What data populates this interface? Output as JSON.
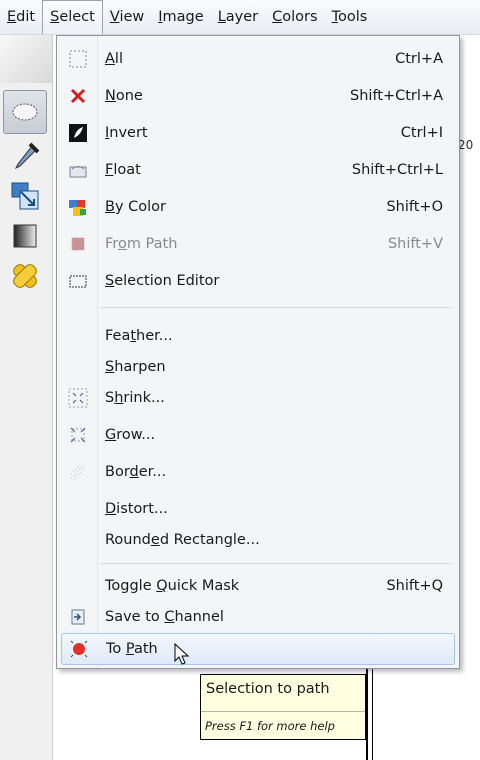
{
  "menubar": {
    "items": [
      {
        "label": "Edit",
        "mnemonic": "E"
      },
      {
        "label": "Select",
        "mnemonic": "S"
      },
      {
        "label": "View",
        "mnemonic": "V"
      },
      {
        "label": "Image",
        "mnemonic": "I"
      },
      {
        "label": "Layer",
        "mnemonic": "L"
      },
      {
        "label": "Colors",
        "mnemonic": "C"
      },
      {
        "label": "Tools",
        "mnemonic": "T"
      }
    ],
    "active": "Select"
  },
  "ruler": {
    "label": "20"
  },
  "select_menu": {
    "items": [
      {
        "label": "All",
        "underline": "A",
        "shortcut": "Ctrl+A",
        "icon": "select-all-icon"
      },
      {
        "label": "None",
        "underline": "N",
        "shortcut": "Shift+Ctrl+A",
        "icon": "select-none-icon"
      },
      {
        "label": "Invert",
        "underline": "I",
        "shortcut": "Ctrl+I",
        "icon": "invert-icon"
      },
      {
        "label": "Float",
        "underline": "F",
        "shortcut": "Shift+Ctrl+L",
        "icon": "float-icon"
      },
      {
        "label": "By Color",
        "underline": "B",
        "shortcut": "Shift+O",
        "icon": "by-color-icon"
      },
      {
        "label": "From Path",
        "underline": "o",
        "shortcut": "Shift+V",
        "icon": "from-path-icon",
        "disabled": true
      },
      {
        "label": "Selection Editor",
        "underline": "S",
        "shortcut": "",
        "icon": "selection-editor-icon"
      },
      {
        "label": "Feather...",
        "underline": "t",
        "shortcut": ""
      },
      {
        "label": "Sharpen",
        "underline": "S",
        "shortcut": ""
      },
      {
        "label": "Shrink...",
        "underline": "h",
        "shortcut": "",
        "icon": "shrink-icon"
      },
      {
        "label": "Grow...",
        "underline": "G",
        "shortcut": "",
        "icon": "grow-icon"
      },
      {
        "label": "Border...",
        "underline": "d",
        "shortcut": "",
        "icon": "border-icon"
      },
      {
        "label": "Distort...",
        "underline": "D",
        "shortcut": ""
      },
      {
        "label": "Rounded Rectangle...",
        "underline": "e",
        "shortcut": ""
      },
      {
        "label": "Toggle Quick Mask",
        "underline": "Q",
        "shortcut": "Shift+Q"
      },
      {
        "label": "Save to Channel",
        "underline": "C",
        "shortcut": "",
        "icon": "save-to-channel-icon"
      },
      {
        "label": "To Path",
        "underline": "P",
        "shortcut": "",
        "icon": "to-path-icon",
        "highlighted": true
      }
    ]
  },
  "tooltip": {
    "title": "Selection to path",
    "help": "Press F1 for more help"
  }
}
